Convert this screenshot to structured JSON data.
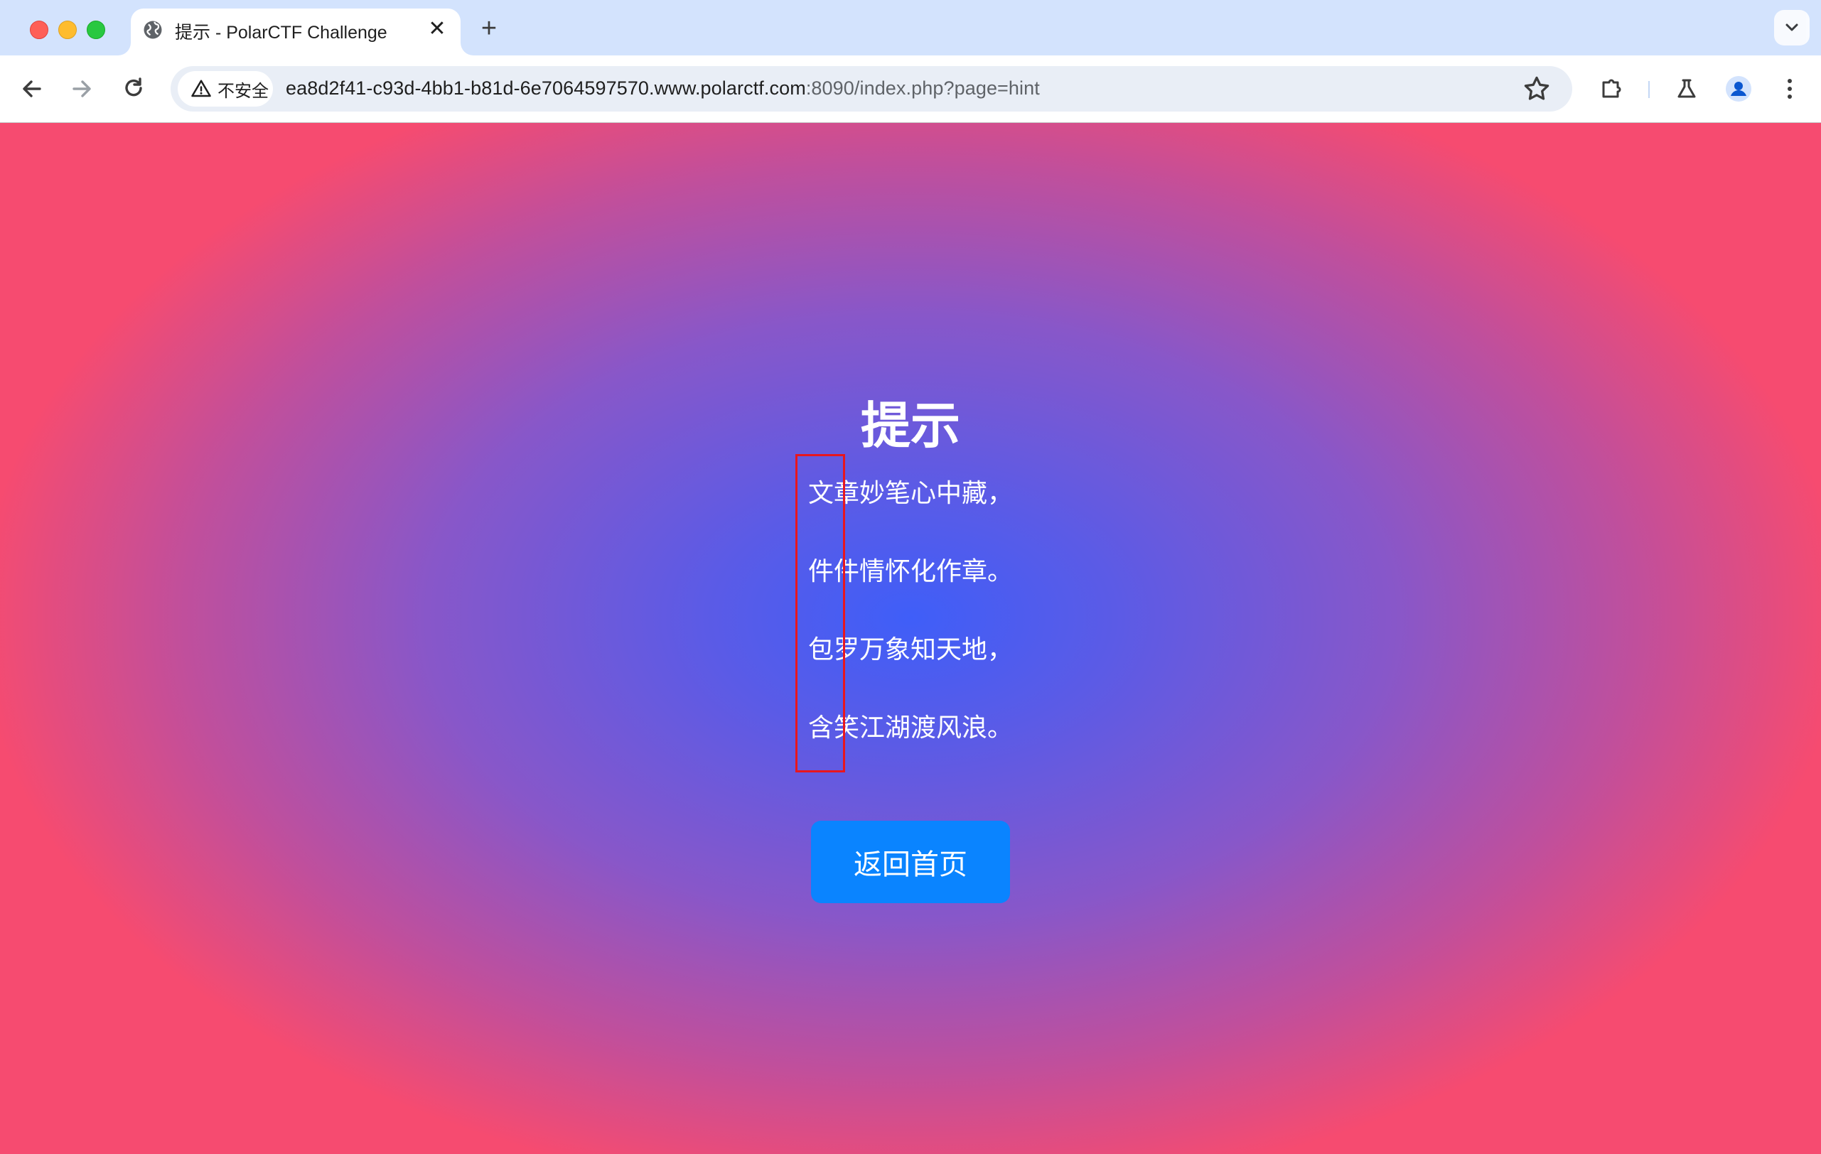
{
  "browser": {
    "tab": {
      "title": "提示 - PolarCTF Challenge",
      "close_glyph": "✕"
    },
    "new_tab_glyph": "+",
    "omnibox": {
      "security_label": "不安全",
      "url_prefix": "ea8d2f41-c93d-4bb1-b81d-6e7064597570.www.polarctf.com",
      "url_suffix": ":8090/index.php?page=hint"
    },
    "icons": {
      "favicon": "globe-icon",
      "back": "arrow-left-icon",
      "forward": "arrow-right-icon",
      "reload": "reload-icon",
      "warning": "warning-triangle-icon",
      "bookmark": "star-icon",
      "extensions": "puzzle-icon",
      "labs": "flask-icon",
      "profile": "person-icon",
      "menu": "kebab-menu-icon",
      "tab_search": "chevron-down-icon"
    }
  },
  "page": {
    "title": "提示",
    "poem": [
      "文章妙笔心中藏，",
      "件件情怀化作章。",
      "包罗万象知天地，",
      "含笑江湖渡风浪。"
    ],
    "home_button_label": "返回首页",
    "highlight_color": "#e8161e",
    "button_color": "#0a84ff"
  }
}
